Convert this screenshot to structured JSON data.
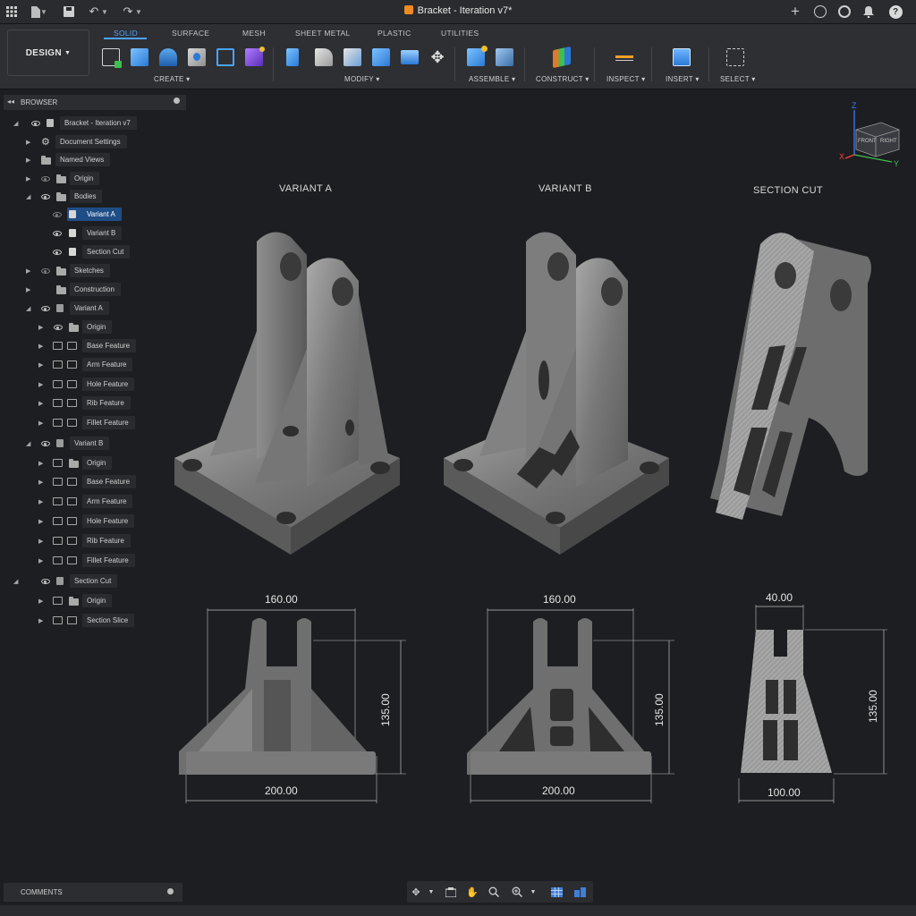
{
  "titlebar": {
    "doc_title": "Bracket - Iteration v7*"
  },
  "toolbar": {
    "workspace": "DESIGN",
    "tabs": [
      "SOLID",
      "SURFACE",
      "MESH",
      "SHEET METAL",
      "PLASTIC",
      "UTILITIES"
    ],
    "active_tab": "SOLID",
    "groups": [
      "CREATE",
      "MODIFY",
      "ASSEMBLE",
      "CONSTRUCT",
      "INSPECT",
      "INSERT",
      "SELECT"
    ]
  },
  "browser": {
    "title": "BROWSER",
    "items": [
      "Bracket - Iteration v7",
      "Document Settings",
      "Named Views",
      "Origin",
      "Bodies",
      "Variant A",
      "Variant B",
      "Section Cut",
      "Sketches",
      "Construction",
      "Variant A",
      "Origin",
      "Base Feature",
      "Arm Feature",
      "Hole Feature",
      "Rib Feature",
      "Fillet Feature",
      "Variant B",
      "Origin",
      "Base Feature",
      "Arm Feature",
      "Hole Feature",
      "Rib Feature",
      "Fillet Feature",
      "Section Cut",
      "Origin",
      "Section Slice"
    ]
  },
  "viewport": {
    "labels": [
      "VARIANT A",
      "VARIANT B",
      "SECTION CUT"
    ],
    "viewcube": {
      "front": "FRONT",
      "right": "RIGHT",
      "x": "X",
      "y": "Y",
      "z": "Z"
    },
    "dimensions": {
      "a_top": "160.00",
      "a_side": "135.00",
      "a_bottom": "200.00",
      "b_top": "160.00",
      "b_side": "135.00",
      "b_bottom": "200.00",
      "c_top": "40.00",
      "c_side": "135.00",
      "c_bottom": "100.00"
    }
  },
  "comments": {
    "title": "COMMENTS"
  },
  "colors": {
    "accent": "#4ea3ff",
    "selection": "#1f4d86",
    "brand": "#f08a24"
  }
}
